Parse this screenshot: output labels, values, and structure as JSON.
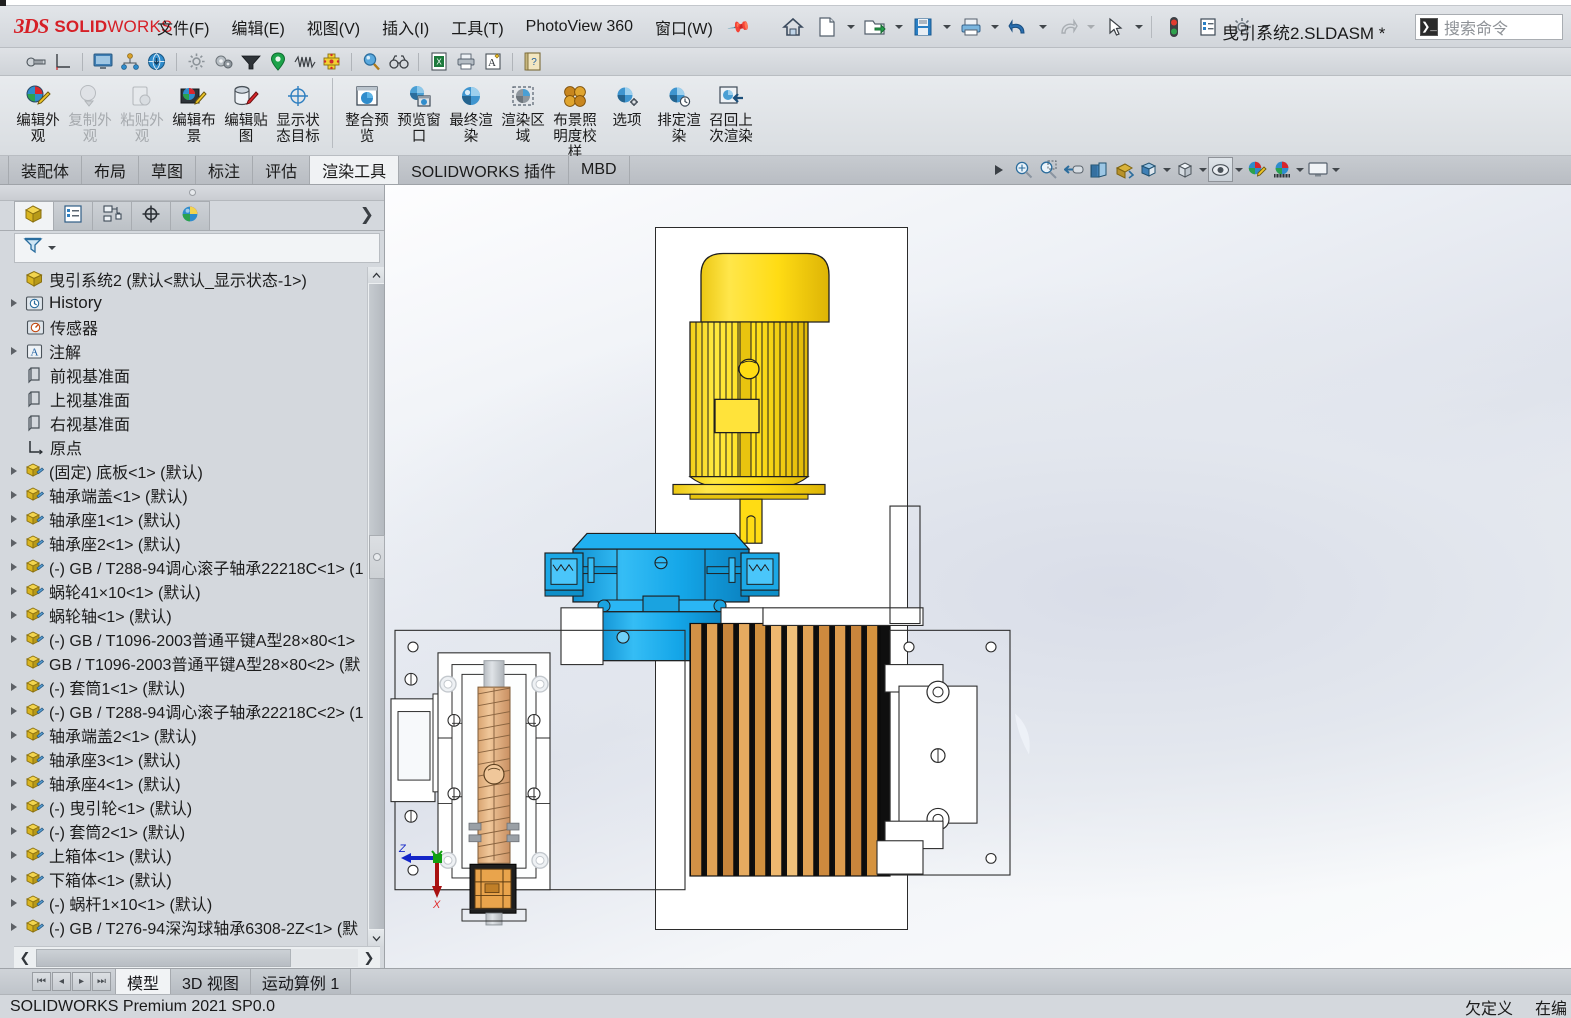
{
  "window": {
    "document_title": "曳引系统2.SLDASM *",
    "logo_ds": "3DS",
    "logo_bold": "SOLID",
    "logo_light": "WORKS"
  },
  "menu": {
    "items": [
      {
        "label": "文件(F)",
        "name": "menu-file"
      },
      {
        "label": "编辑(E)",
        "name": "menu-edit"
      },
      {
        "label": "视图(V)",
        "name": "menu-view"
      },
      {
        "label": "插入(I)",
        "name": "menu-insert"
      },
      {
        "label": "工具(T)",
        "name": "menu-tools"
      },
      {
        "label": "PhotoView 360",
        "name": "menu-photoview360"
      },
      {
        "label": "窗口(W)",
        "name": "menu-window"
      }
    ],
    "pin_icon": "pin-icon"
  },
  "quick_access": {
    "buttons": [
      {
        "name": "home-icon",
        "has_dropdown": false
      },
      {
        "name": "new-document-icon",
        "has_dropdown": true
      },
      {
        "name": "open-document-icon",
        "has_dropdown": true
      },
      {
        "name": "save-icon",
        "has_dropdown": true
      },
      {
        "name": "print-icon",
        "has_dropdown": true
      },
      {
        "name": "undo-icon",
        "has_dropdown": true
      },
      {
        "name": "redo-icon",
        "has_dropdown": true,
        "disabled": true
      },
      {
        "name": "select-cursor-icon",
        "has_dropdown": true
      },
      {
        "name": "rebuild-icon",
        "has_dropdown": false
      },
      {
        "name": "options-list-icon",
        "has_dropdown": false
      },
      {
        "name": "settings-gear-icon",
        "has_dropdown": true
      }
    ]
  },
  "search": {
    "placeholder": "搜索命令",
    "icon": "command-search-icon"
  },
  "toolbar2": {
    "buttons": [
      {
        "name": "bolt-fastener-icon"
      },
      {
        "name": "measure-axis-icon"
      },
      {
        "name": "display-monitor-icon"
      },
      {
        "name": "assembly-tree-icon"
      },
      {
        "name": "globe-download-icon"
      },
      {
        "name": "gear-settings-icon"
      },
      {
        "name": "gears-motion-icon"
      },
      {
        "name": "funnel-dark-icon"
      },
      {
        "name": "location-pin-green-icon"
      },
      {
        "name": "spring-coil-icon"
      },
      {
        "name": "mates-cross-icon"
      },
      {
        "name": "zoom-sphere-icon"
      },
      {
        "name": "binoculars-icon"
      },
      {
        "name": "excel-export-icon"
      },
      {
        "name": "print-small-icon"
      },
      {
        "name": "annotation-note-icon"
      },
      {
        "name": "notebook-help-icon"
      }
    ]
  },
  "ribbon": {
    "groups": [
      {
        "items": [
          {
            "label": "编辑外观",
            "icon": "edit-appearance-icon",
            "disabled": false,
            "name": "ribbon-edit-appearance"
          },
          {
            "label": "复制外观",
            "icon": "copy-appearance-icon",
            "disabled": true,
            "name": "ribbon-copy-appearance"
          },
          {
            "label": "粘贴外观",
            "icon": "paste-appearance-icon",
            "disabled": true,
            "name": "ribbon-paste-appearance"
          },
          {
            "label": "编辑布景",
            "icon": "edit-scene-icon",
            "disabled": false,
            "name": "ribbon-edit-scene"
          },
          {
            "label": "编辑贴图",
            "icon": "edit-decal-icon",
            "disabled": false,
            "name": "ribbon-edit-decal"
          },
          {
            "label": "显示状态目标",
            "icon": "display-state-target-icon",
            "disabled": false,
            "name": "ribbon-display-state-target"
          }
        ]
      },
      {
        "items": [
          {
            "label": "整合预览",
            "icon": "integrated-preview-icon",
            "disabled": false,
            "name": "ribbon-integrated-preview"
          },
          {
            "label": "预览窗口",
            "icon": "preview-window-icon",
            "disabled": false,
            "name": "ribbon-preview-window"
          },
          {
            "label": "最终渲染",
            "icon": "final-render-icon",
            "disabled": false,
            "name": "ribbon-final-render"
          },
          {
            "label": "渲染区域",
            "icon": "render-region-icon",
            "disabled": false,
            "name": "ribbon-render-region"
          },
          {
            "label": "布景照明度校样",
            "icon": "scene-illumination-proof-icon",
            "disabled": false,
            "name": "ribbon-scene-illumination-proof"
          },
          {
            "label": "选项",
            "icon": "render-options-icon",
            "disabled": false,
            "name": "ribbon-options"
          },
          {
            "label": "排定渲染",
            "icon": "schedule-render-icon",
            "disabled": false,
            "name": "ribbon-schedule-render"
          },
          {
            "label": "召回上次渲染",
            "icon": "recall-last-render-icon",
            "disabled": false,
            "name": "ribbon-recall-last-render"
          }
        ]
      }
    ]
  },
  "command_tabs": {
    "active": "渲染工具",
    "items": [
      {
        "label": "装配体",
        "name": "tab-assembly"
      },
      {
        "label": "布局",
        "name": "tab-layout"
      },
      {
        "label": "草图",
        "name": "tab-sketch"
      },
      {
        "label": "标注",
        "name": "tab-markup"
      },
      {
        "label": "评估",
        "name": "tab-evaluate"
      },
      {
        "label": "渲染工具",
        "name": "tab-render-tools"
      },
      {
        "label": "SOLIDWORKS 插件",
        "name": "tab-solidworks-addins"
      },
      {
        "label": "MBD",
        "name": "tab-mbd"
      }
    ]
  },
  "view_toolbar": {
    "buttons": [
      {
        "name": "play-arrow-icon",
        "dropdown": false
      },
      {
        "name": "zoom-to-fit-icon",
        "dropdown": false
      },
      {
        "name": "zoom-to-area-icon",
        "dropdown": false
      },
      {
        "name": "previous-view-icon",
        "dropdown": false
      },
      {
        "name": "section-view-icon",
        "dropdown": false
      },
      {
        "name": "view-orientation-icon",
        "dropdown": false
      },
      {
        "name": "display-style-icon",
        "dropdown": true
      },
      {
        "name": "view-orientation-cube-icon",
        "dropdown": true
      },
      {
        "name": "hide-show-items-icon",
        "dropdown": true,
        "selected": true
      },
      {
        "name": "edit-appearance-small-icon",
        "dropdown": false
      },
      {
        "name": "apply-scene-icon",
        "dropdown": true
      },
      {
        "name": "view-settings-display-icon",
        "dropdown": true
      }
    ]
  },
  "feature_panel": {
    "tabs": [
      {
        "name": "featuremanager-design-tree-tab",
        "icon": "feature-tree-icon",
        "active": true
      },
      {
        "name": "property-manager-tab",
        "icon": "property-manager-icon",
        "active": false
      },
      {
        "name": "configuration-manager-tab",
        "icon": "configuration-manager-icon",
        "active": false
      },
      {
        "name": "dimxpert-manager-tab",
        "icon": "dimxpert-icon",
        "active": false
      },
      {
        "name": "display-manager-tab",
        "icon": "display-manager-icon",
        "active": false
      }
    ],
    "expand_icon": "chevron-right-icon",
    "filter": {
      "icon": "filter-funnel-icon",
      "value": "",
      "dropdown_icon": "caret-down-icon"
    },
    "root": {
      "label": "曳引系统2  (默认<默认_显示状态-1>)",
      "icon": "assembly-icon"
    },
    "items": [
      {
        "label": "History",
        "icon": "history-icon",
        "twisty": true,
        "indent": 1,
        "latin": true
      },
      {
        "label": "传感器",
        "icon": "sensors-icon",
        "twisty": false,
        "indent": 2
      },
      {
        "label": "注解",
        "icon": "annotations-icon",
        "twisty": true,
        "indent": 1
      },
      {
        "label": "前视基准面",
        "icon": "plane-icon",
        "twisty": false,
        "indent": 2
      },
      {
        "label": "上视基准面",
        "icon": "plane-icon",
        "twisty": false,
        "indent": 2
      },
      {
        "label": "右视基准面",
        "icon": "plane-icon",
        "twisty": false,
        "indent": 2
      },
      {
        "label": "原点",
        "icon": "origin-icon",
        "twisty": false,
        "indent": 2
      },
      {
        "label": "(固定) 底板<1> (默认)",
        "icon": "component-icon",
        "twisty": true,
        "indent": 1
      },
      {
        "label": "轴承端盖<1> (默认)",
        "icon": "component-icon",
        "twisty": true,
        "indent": 1
      },
      {
        "label": "轴承座1<1> (默认)",
        "icon": "component-icon",
        "twisty": true,
        "indent": 1
      },
      {
        "label": "轴承座2<1> (默认)",
        "icon": "component-icon",
        "twisty": true,
        "indent": 1
      },
      {
        "label": "(-) GB / T288-94调心滚子轴承22218C<1> (1",
        "icon": "component-icon",
        "twisty": true,
        "indent": 1
      },
      {
        "label": "蜗轮41×10<1> (默认)",
        "icon": "component-icon",
        "twisty": true,
        "indent": 1
      },
      {
        "label": "蜗轮轴<1> (默认)",
        "icon": "component-icon",
        "twisty": true,
        "indent": 1
      },
      {
        "label": "(-) GB / T1096-2003普通平键A型28×80<1>",
        "icon": "component-icon",
        "twisty": true,
        "indent": 1
      },
      {
        "label": "GB / T1096-2003普通平键A型28×80<2> (默",
        "icon": "component-icon",
        "twisty": false,
        "indent": 1
      },
      {
        "label": "(-) 套筒1<1> (默认)",
        "icon": "component-icon",
        "twisty": true,
        "indent": 1
      },
      {
        "label": "(-) GB / T288-94调心滚子轴承22218C<2> (1",
        "icon": "component-icon",
        "twisty": true,
        "indent": 1
      },
      {
        "label": "轴承端盖2<1> (默认)",
        "icon": "component-icon",
        "twisty": true,
        "indent": 1
      },
      {
        "label": "轴承座3<1> (默认)",
        "icon": "component-icon",
        "twisty": true,
        "indent": 1
      },
      {
        "label": "轴承座4<1> (默认)",
        "icon": "component-icon",
        "twisty": true,
        "indent": 1
      },
      {
        "label": "(-) 曳引轮<1> (默认)",
        "icon": "component-icon",
        "twisty": true,
        "indent": 1
      },
      {
        "label": "(-) 套筒2<1> (默认)",
        "icon": "component-icon",
        "twisty": true,
        "indent": 1
      },
      {
        "label": "上箱体<1> (默认)",
        "icon": "component-icon",
        "twisty": true,
        "indent": 1
      },
      {
        "label": "下箱体<1> (默认)",
        "icon": "component-icon",
        "twisty": true,
        "indent": 1
      },
      {
        "label": "(-) 蜗杆1×10<1> (默认)",
        "icon": "component-icon",
        "twisty": true,
        "indent": 1
      },
      {
        "label": "(-) GB / T276-94深沟球轴承6308-2Z<1> (默",
        "icon": "component-icon",
        "twisty": true,
        "indent": 1
      }
    ]
  },
  "viewport": {
    "axis_triad": {
      "z_label": "Z",
      "x_label": "X",
      "z_color": "#1426c8",
      "x_color": "#a81111",
      "y_color": "#12a012"
    },
    "model": {
      "motor_color": "#ffe01b",
      "gearbox_color": "#18a8e8",
      "brake_coil_color": "#c8861f",
      "spring_color": "#e3b585"
    }
  },
  "bottom_tabs": {
    "nav_first": "first-icon",
    "nav_prev": "prev-icon",
    "nav_next": "next-icon",
    "nav_last": "last-icon",
    "active": "模型",
    "items": [
      {
        "label": "模型",
        "name": "bottom-tab-model"
      },
      {
        "label": "3D 视图",
        "name": "bottom-tab-3d-views"
      },
      {
        "label": "运动算例 1",
        "name": "bottom-tab-motion-study-1"
      }
    ]
  },
  "status_bar": {
    "left": "SOLIDWORKS Premium 2021 SP0.0",
    "right": [
      "欠定义",
      "在编"
    ]
  }
}
